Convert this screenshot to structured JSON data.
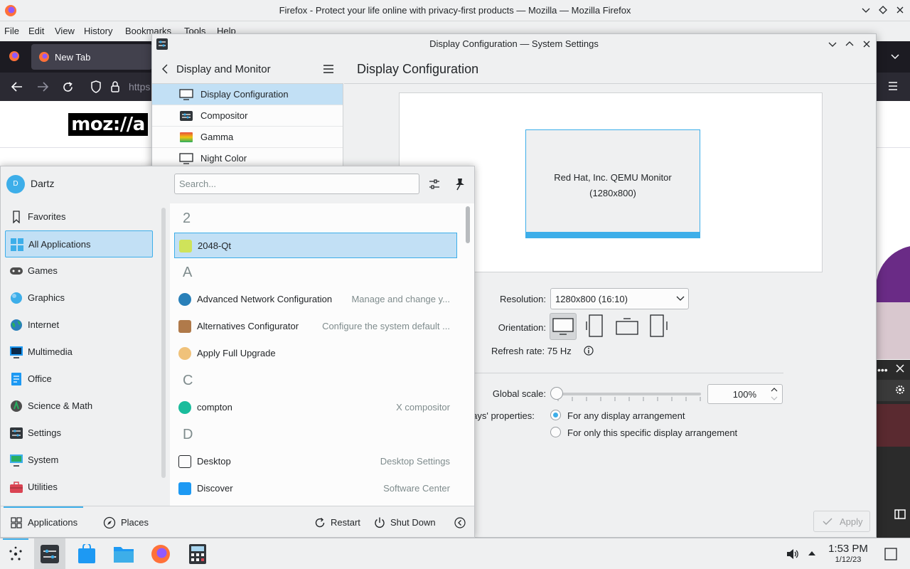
{
  "firefox": {
    "title": "Firefox - Protect your life online with privacy-first products — Mozilla — Mozilla Firefox",
    "menu": [
      "File",
      "Edit",
      "View",
      "History",
      "Bookmarks",
      "Tools",
      "Help"
    ],
    "tab_label": "New Tab",
    "url_fragment": "https",
    "logo_text": "moz://a"
  },
  "settings": {
    "window_title": "Display Configuration — System Settings",
    "sidebar_header": "Display and Monitor",
    "sidebar_items": [
      {
        "label": "Display Configuration",
        "icon": "monitor-icon",
        "selected": true
      },
      {
        "label": "Compositor",
        "icon": "compositor-icon"
      },
      {
        "label": "Gamma",
        "icon": "gamma-icon"
      },
      {
        "label": "Night Color",
        "icon": "night-color-icon"
      }
    ],
    "page_title": "Display Configuration",
    "monitor_name": "Red Hat, Inc. QEMU Monitor",
    "monitor_res": "(1280x800)",
    "resolution_label": "Resolution:",
    "resolution_value": "1280x800 (16:10)",
    "orientation_label": "Orientation:",
    "refresh_label": "Refresh rate: 75 Hz",
    "global_scale_label": "Global scale:",
    "global_scale_value": "100%",
    "global_scale_fraction": 0.0,
    "properties_label": "plays' properties:",
    "radio_any": "For any display arrangement",
    "radio_specific": "For only this specific display arrangement",
    "apply_label": "Apply"
  },
  "launcher": {
    "user_initial": "D",
    "user_name": "Dartz",
    "search_placeholder": "Search...",
    "categories": [
      {
        "label": "Favorites",
        "icon": "bookmark-icon"
      },
      {
        "label": "All Applications",
        "icon": "grid-icon",
        "selected": true
      },
      {
        "label": "Games",
        "icon": "gamepad-icon"
      },
      {
        "label": "Graphics",
        "icon": "graphics-icon"
      },
      {
        "label": "Internet",
        "icon": "globe-icon"
      },
      {
        "label": "Multimedia",
        "icon": "multimedia-icon"
      },
      {
        "label": "Office",
        "icon": "office-icon"
      },
      {
        "label": "Science & Math",
        "icon": "science-icon"
      },
      {
        "label": "Settings",
        "icon": "settings-icon"
      },
      {
        "label": "System",
        "icon": "system-icon"
      },
      {
        "label": "Utilities",
        "icon": "utilities-icon"
      }
    ],
    "sections": {
      "s2": "2",
      "sa": "A",
      "sc": "C",
      "sd": "D"
    },
    "apps": {
      "app_2048": {
        "name": "2048-Qt",
        "desc": ""
      },
      "app_anc": {
        "name": "Advanced Network Configuration",
        "desc": "Manage and change y..."
      },
      "app_alt": {
        "name": "Alternatives Configurator",
        "desc": "Configure the system default ..."
      },
      "app_afu": {
        "name": "Apply Full Upgrade",
        "desc": ""
      },
      "app_compton": {
        "name": "compton",
        "desc": "X compositor"
      },
      "app_desktop": {
        "name": "Desktop",
        "desc": "Desktop Settings"
      },
      "app_discover": {
        "name": "Discover",
        "desc": "Software Center"
      }
    },
    "footer": {
      "applications": "Applications",
      "places": "Places",
      "restart": "Restart",
      "shutdown": "Shut Down"
    }
  },
  "taskbar": {
    "time": "1:53 PM",
    "date": "1/12/23"
  }
}
